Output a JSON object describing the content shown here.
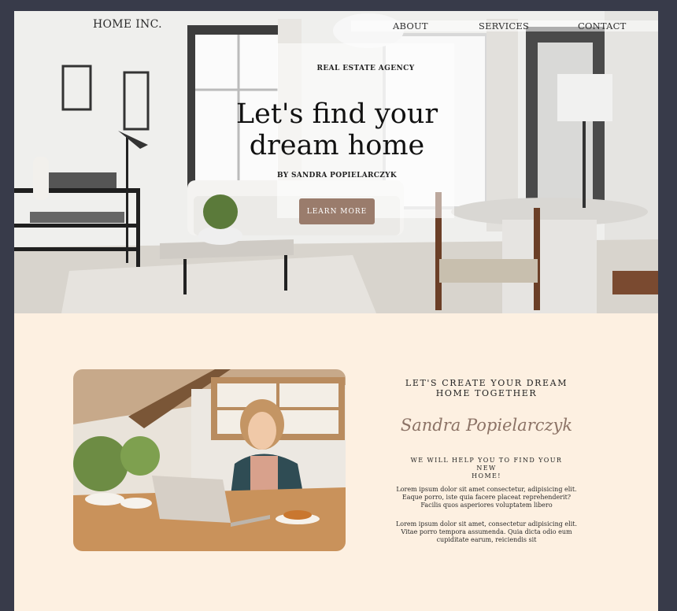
{
  "brand": "HOME INC.",
  "nav": {
    "about": "ABOUT",
    "services": "SERVICES",
    "contact": "CONTACT"
  },
  "hero": {
    "eyebrow": "REAL ESTATE AGENCY",
    "headline_line1": "Let's find your",
    "headline_line2": "dream home",
    "byline": "BY SANDRA POPIELARCZYK",
    "cta_label": "LEARN MORE"
  },
  "about": {
    "title_line1": "LET'S CREATE YOUR DREAM",
    "title_line2": "HOME TOGETHER",
    "signature": "Sandra Popielarczyk",
    "subtitle_line1": "WE WILL HELP YOU TO FIND YOUR NEW",
    "subtitle_line2": "HOME!",
    "paragraph1": "Lorem ipsum dolor sit amet consectetur, adipisicing elit. Eaque porro, iste quia facere placeat reprehenderit? Facilis quos asperiores voluptatem libero",
    "paragraph2": "Lorem ipsum dolor sit amet, consectetur adipisicing elit. Vitae porro tempora assumenda. Quia dicta odio eum cupiditate earum, reiciendis sit"
  },
  "colors": {
    "page_bg": "#383b4a",
    "section_bg": "#fdf0e1",
    "accent": "#9a7c6c",
    "signature": "#8c7366"
  }
}
